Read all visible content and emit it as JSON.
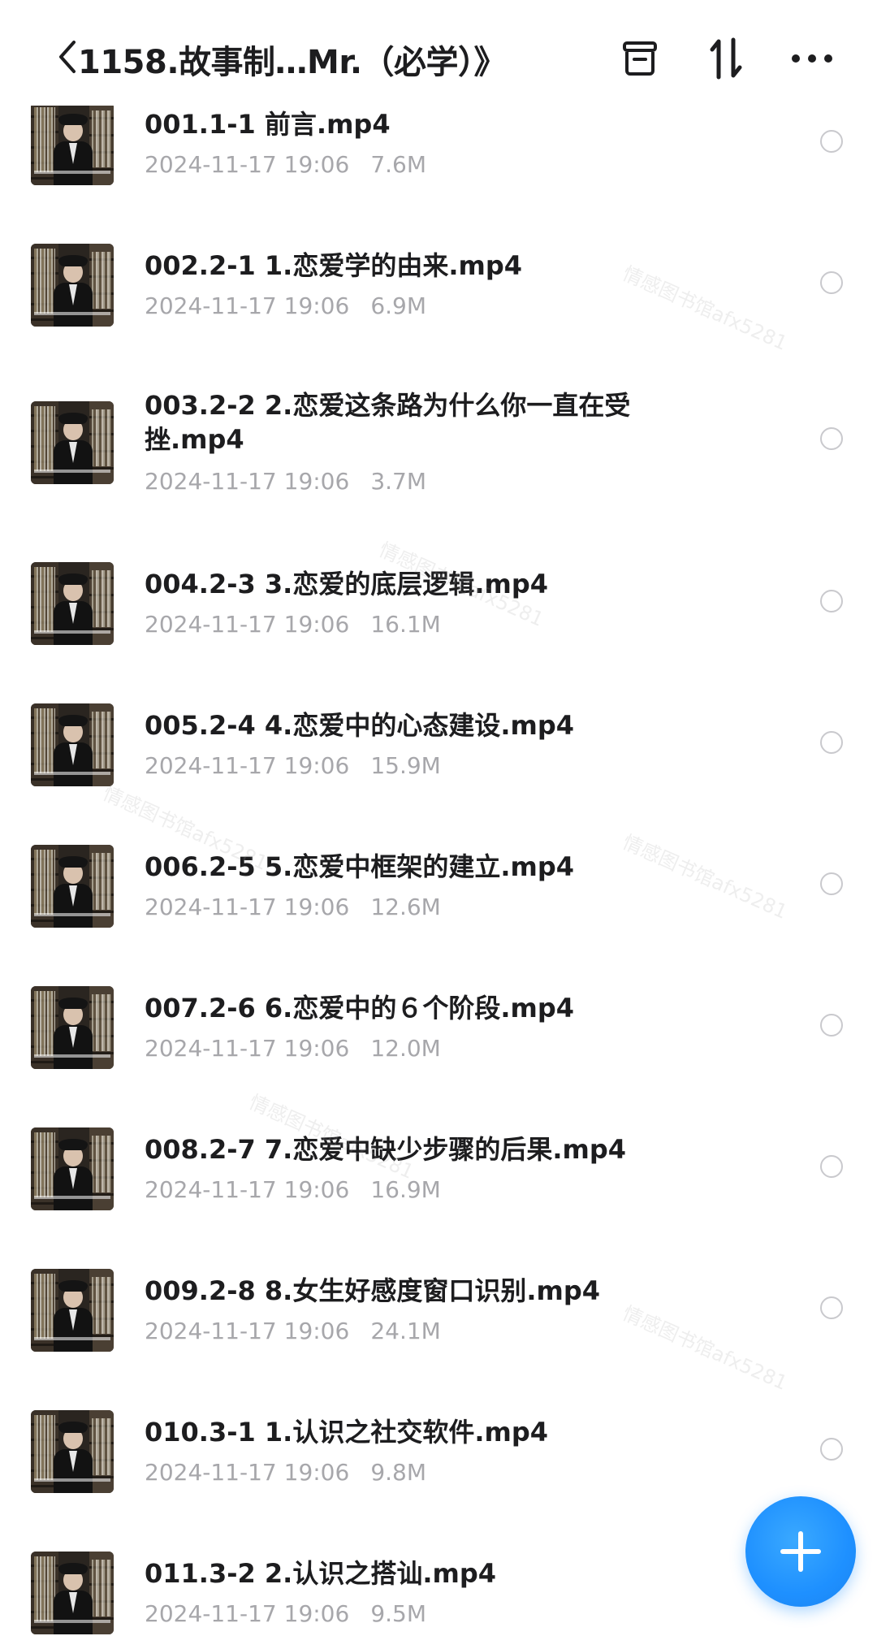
{
  "header": {
    "title": "1158.故事制…Mr.（必学）》",
    "back_icon": "chevron-left-icon",
    "actions": [
      "archive-icon",
      "sort-icon",
      "more-icon"
    ]
  },
  "files": [
    {
      "name": "001.1-1 前言.mp4",
      "date": "2024-11-17 19:06",
      "size": "7.6M"
    },
    {
      "name": "002.2-1 1.恋爱学的由来.mp4",
      "date": "2024-11-17 19:06",
      "size": "6.9M"
    },
    {
      "name": "003.2-2 2.恋爱这条路为什么你一直在受挫.mp4",
      "date": "2024-11-17 19:06",
      "size": "3.7M"
    },
    {
      "name": "004.2-3 3.恋爱的底层逻辑.mp4",
      "date": "2024-11-17 19:06",
      "size": "16.1M"
    },
    {
      "name": "005.2-4 4.恋爱中的心态建设.mp4",
      "date": "2024-11-17 19:06",
      "size": "15.9M"
    },
    {
      "name": "006.2-5 5.恋爱中框架的建立.mp4",
      "date": "2024-11-17 19:06",
      "size": "12.6M"
    },
    {
      "name": "007.2-6 6.恋爱中的６个阶段.mp4",
      "date": "2024-11-17 19:06",
      "size": "12.0M"
    },
    {
      "name": "008.2-7 7.恋爱中缺少步骤的后果.mp4",
      "date": "2024-11-17 19:06",
      "size": "16.9M"
    },
    {
      "name": "009.2-8 8.女生好感度窗口识别.mp4",
      "date": "2024-11-17 19:06",
      "size": "24.1M"
    },
    {
      "name": "010.3-1 1.认识之社交软件.mp4",
      "date": "2024-11-17 19:06",
      "size": "9.8M"
    },
    {
      "name": "011.3-2 2.认识之搭讪.mp4",
      "date": "2024-11-17 19:06",
      "size": "9.5M"
    }
  ],
  "fab": {
    "icon": "plus-icon",
    "color": "#1e90ff"
  },
  "watermark": "情感图书馆afx5281"
}
